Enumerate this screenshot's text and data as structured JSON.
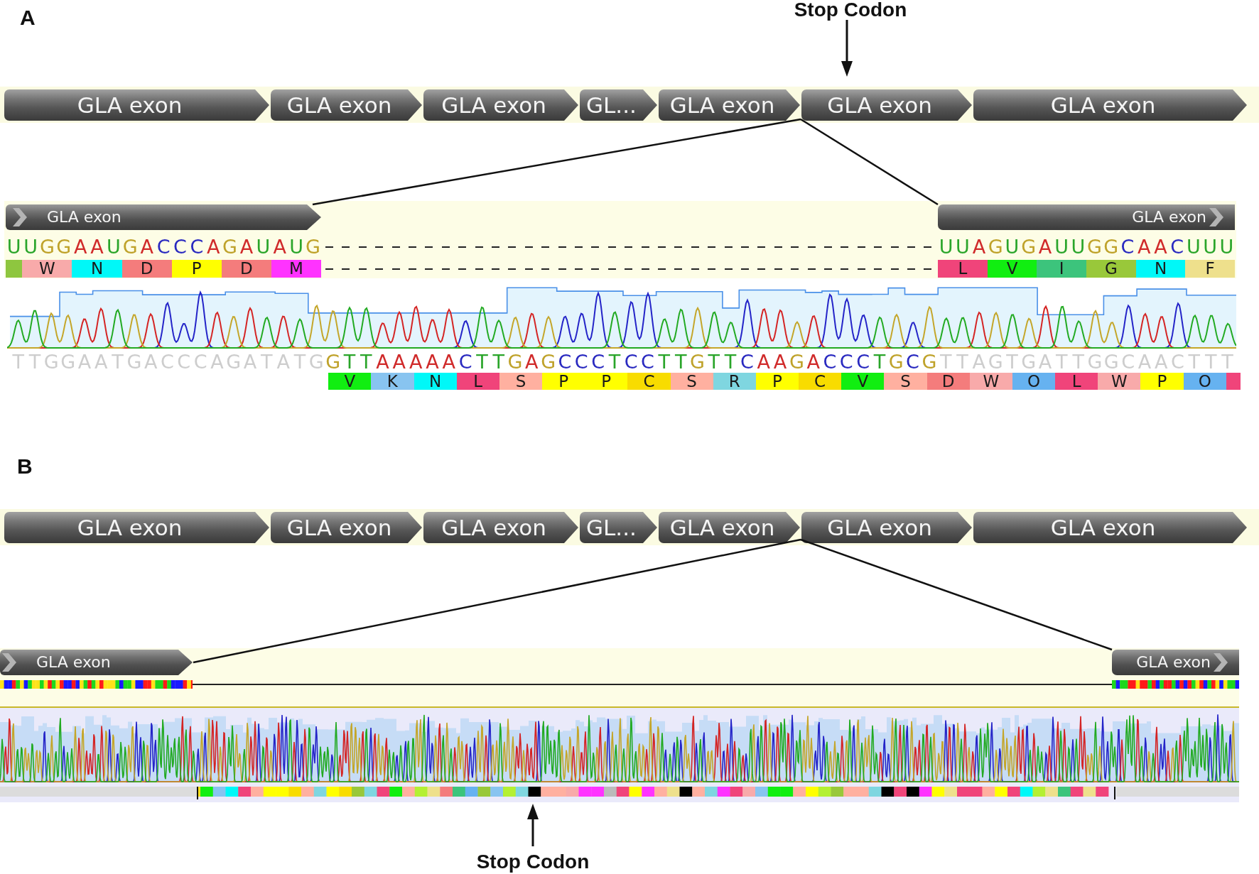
{
  "panel_a": {
    "label": "A",
    "stop_codon_callout": "Stop Codon",
    "exon_track": [
      {
        "label": "GLA exon"
      },
      {
        "label": "GLA exon"
      },
      {
        "label": "GLA exon"
      },
      {
        "label": "GL..."
      },
      {
        "label": "GLA exon"
      },
      {
        "label": "GLA exon"
      },
      {
        "label": "GLA exon"
      }
    ],
    "zoom_view": {
      "left_exon": {
        "label": "GLA exon"
      },
      "right_exon": {
        "label": "GLA exon"
      },
      "rna_left": "UUGGAAUGACCCAGAUAUG",
      "rna_right": "UUAGUGAUUGGCAACUUU",
      "translation_left": [
        {
          "kind": "partial",
          "color": "#8ec63f"
        },
        {
          "kind": "codon",
          "letter": "W",
          "color": "#f8aaaa"
        },
        {
          "kind": "codon",
          "letter": "N",
          "color": "#00f8f8"
        },
        {
          "kind": "codon",
          "letter": "D",
          "color": "#f47c7c"
        },
        {
          "kind": "codon",
          "letter": "P",
          "color": "#ffff00"
        },
        {
          "kind": "codon",
          "letter": "D",
          "color": "#f47c7c"
        },
        {
          "kind": "codon",
          "letter": "M",
          "color": "#ff33ff"
        }
      ],
      "translation_right": [
        {
          "kind": "codon",
          "letter": "L",
          "color": "#f0447a"
        },
        {
          "kind": "codon",
          "letter": "V",
          "color": "#11ee11"
        },
        {
          "kind": "codon",
          "letter": "I",
          "color": "#3cc47c"
        },
        {
          "kind": "codon",
          "letter": "G",
          "color": "#99c83a"
        },
        {
          "kind": "codon",
          "letter": "N",
          "color": "#00f8f8"
        },
        {
          "kind": "codon",
          "letter": "F",
          "color": "#eee08c"
        }
      ]
    },
    "trace": {
      "bases": [
        {
          "bases": "TTGGAATGACCCAGATATG",
          "trimmed": true
        },
        {
          "bases": "GTTAAAAACTTGAGCCCTCCTTGTTCAAGACCCTGCG",
          "trimmed": false
        },
        {
          "bases": "TTAGTGATTGGCAACTTT",
          "trimmed": true
        }
      ],
      "translation": [
        {
          "kind": "codon",
          "letter": "V",
          "color": "#11ee11"
        },
        {
          "kind": "codon",
          "letter": "K",
          "color": "#88c4f0"
        },
        {
          "kind": "codon",
          "letter": "N",
          "color": "#00f8f8"
        },
        {
          "kind": "codon",
          "letter": "L",
          "color": "#f0447a"
        },
        {
          "kind": "codon",
          "letter": "S",
          "color": "#ffb0a0"
        },
        {
          "kind": "codon",
          "letter": "P",
          "color": "#ffff00"
        },
        {
          "kind": "codon",
          "letter": "P",
          "color": "#ffff00"
        },
        {
          "kind": "codon",
          "letter": "C",
          "color": "#f8dc00"
        },
        {
          "kind": "codon",
          "letter": "S",
          "color": "#ffb0a0"
        },
        {
          "kind": "codon",
          "letter": "R",
          "color": "#7fd6e0"
        },
        {
          "kind": "codon",
          "letter": "P",
          "color": "#ffff00"
        },
        {
          "kind": "codon",
          "letter": "C",
          "color": "#f8dc00"
        },
        {
          "kind": "codon",
          "letter": "V",
          "color": "#11ee11"
        },
        {
          "kind": "codon",
          "letter": "S",
          "color": "#ffb0a0"
        },
        {
          "kind": "codon",
          "letter": "D",
          "color": "#f47c7c"
        },
        {
          "kind": "codon",
          "letter": "W",
          "color": "#f8aaaa"
        },
        {
          "kind": "codon",
          "letter": "O",
          "color": "#66b2f0"
        },
        {
          "kind": "codon",
          "letter": "L",
          "color": "#f0447a"
        },
        {
          "kind": "codon",
          "letter": "W",
          "color": "#f8aaaa"
        },
        {
          "kind": "codon",
          "letter": "P",
          "color": "#ffff00"
        },
        {
          "kind": "codon",
          "letter": "O",
          "color": "#66b2f0"
        },
        {
          "kind": "partial",
          "color": "#f0447a"
        }
      ]
    }
  },
  "panel_b": {
    "label": "B",
    "exon_track": [
      {
        "label": "GLA exon"
      },
      {
        "label": "GLA exon"
      },
      {
        "label": "GLA exon"
      },
      {
        "label": "GL..."
      },
      {
        "label": "GLA exon"
      },
      {
        "label": "GLA exon"
      },
      {
        "label": "GLA exon"
      }
    ],
    "zoom_view": {
      "left_exon": {
        "label": "GLA exon"
      },
      "right_exon": {
        "label": "GLA exon"
      }
    },
    "stop_codon_callout": "Stop Codon"
  }
}
